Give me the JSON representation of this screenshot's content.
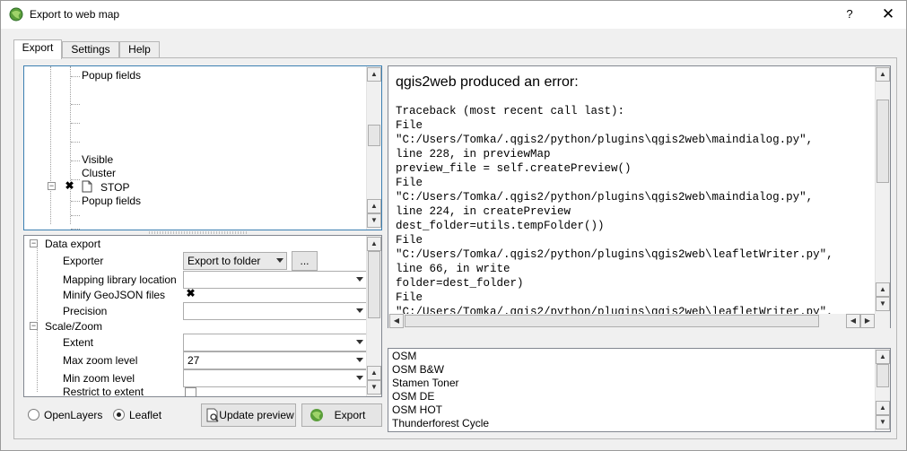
{
  "window": {
    "title": "Export to web map",
    "help_glyph": "?",
    "close_glyph": "✕"
  },
  "tabs": [
    {
      "label": "Export"
    },
    {
      "label": "Settings"
    },
    {
      "label": "Help"
    }
  ],
  "layer_tree": {
    "rows": [
      {
        "label": "Popup fields"
      },
      {
        "label": "Visible"
      },
      {
        "label": "Cluster"
      },
      {
        "label": "STOP"
      },
      {
        "label": "Popup fields"
      }
    ],
    "stop_checked": "✖"
  },
  "props": {
    "data_export": {
      "label": "Data export"
    },
    "exporter": {
      "label": "Exporter",
      "value": "Export to folder",
      "browse": "..."
    },
    "mapping_library": {
      "label": "Mapping library location",
      "value": ""
    },
    "minify": {
      "label": "Minify GeoJSON files",
      "check": "✖"
    },
    "precision": {
      "label": "Precision",
      "value": ""
    },
    "scale_zoom": {
      "label": "Scale/Zoom"
    },
    "extent": {
      "label": "Extent",
      "value": ""
    },
    "max_zoom": {
      "label": "Max zoom level",
      "value": "27"
    },
    "min_zoom": {
      "label": "Min zoom level",
      "value": ""
    },
    "restrict": {
      "label": "Restrict to extent"
    }
  },
  "radios": {
    "openlayers": "OpenLayers",
    "leaflet": "Leaflet",
    "selected": "leaflet"
  },
  "buttons": {
    "update_preview": "Update preview",
    "export": "Export"
  },
  "error": {
    "title": "qgis2web produced an error:",
    "traceback": "Traceback (most recent call last):\nFile\n\"C:/Users/Tomka/.qgis2/python/plugins\\qgis2web\\maindialog.py\",\nline 228, in previewMap\npreview_file = self.createPreview()\nFile\n\"C:/Users/Tomka/.qgis2/python/plugins\\qgis2web\\maindialog.py\",\nline 224, in createPreview\ndest_folder=utils.tempFolder())\nFile\n\"C:/Users/Tomka/.qgis2/python/plugins\\qgis2web\\leafletWriter.py\",\nline 66, in write\nfolder=dest_folder)\nFile\n\"C:/Users/Tomka/.qgis2/python/plugins\\qgis2web\\leafletWriter.py\","
  },
  "basemaps": [
    "OSM",
    "OSM B&W",
    "Stamen Toner",
    "OSM DE",
    "OSM HOT",
    "Thunderforest Cycle"
  ]
}
